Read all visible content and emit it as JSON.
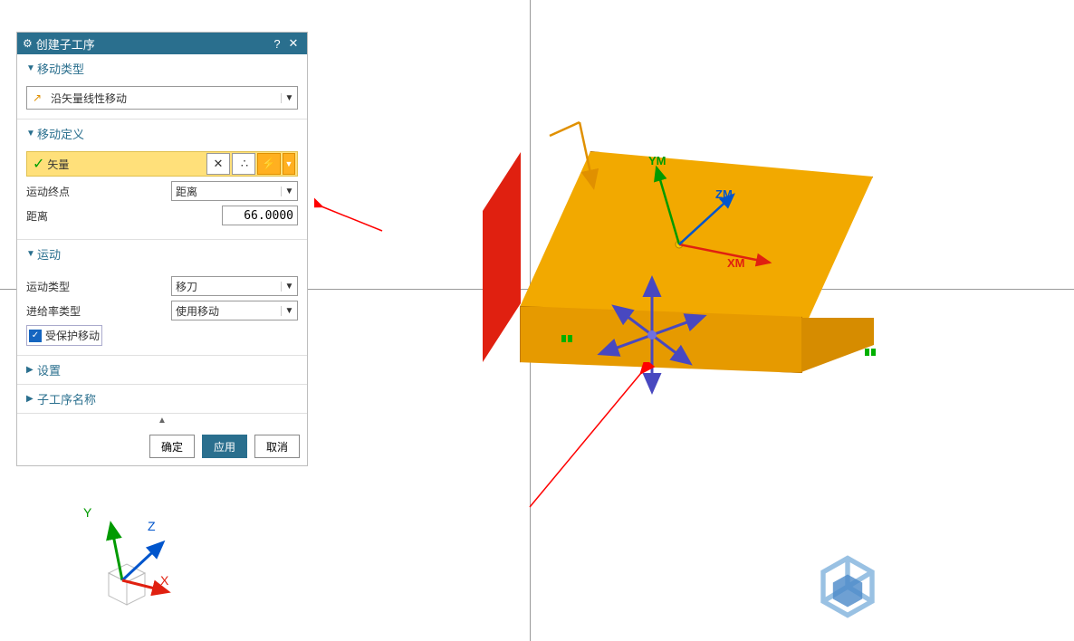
{
  "panel": {
    "title": "创建子工序",
    "sections": {
      "move_type": {
        "header": "移动类型",
        "dropdown_value": "沿矢量线性移动"
      },
      "move_def": {
        "header": "移动定义",
        "vector_label": "矢量",
        "endpoint_label": "运动终点",
        "endpoint_value": "距离",
        "distance_label": "距离",
        "distance_value": "66.0000"
      },
      "motion": {
        "header": "运动",
        "motion_type_label": "运动类型",
        "motion_type_value": "移刀",
        "feedrate_label": "进给率类型",
        "feedrate_value": "使用移动",
        "protected_label": "受保护移动"
      },
      "settings_header": "设置",
      "subop_header": "子工序名称"
    },
    "buttons": {
      "ok": "确定",
      "apply": "应用",
      "cancel": "取消"
    }
  },
  "viewport": {
    "axis_labels": {
      "xm": "XM",
      "ym": "YM",
      "zm": "ZM"
    },
    "triad": {
      "x": "X",
      "y": "Y",
      "z": "Z"
    }
  }
}
